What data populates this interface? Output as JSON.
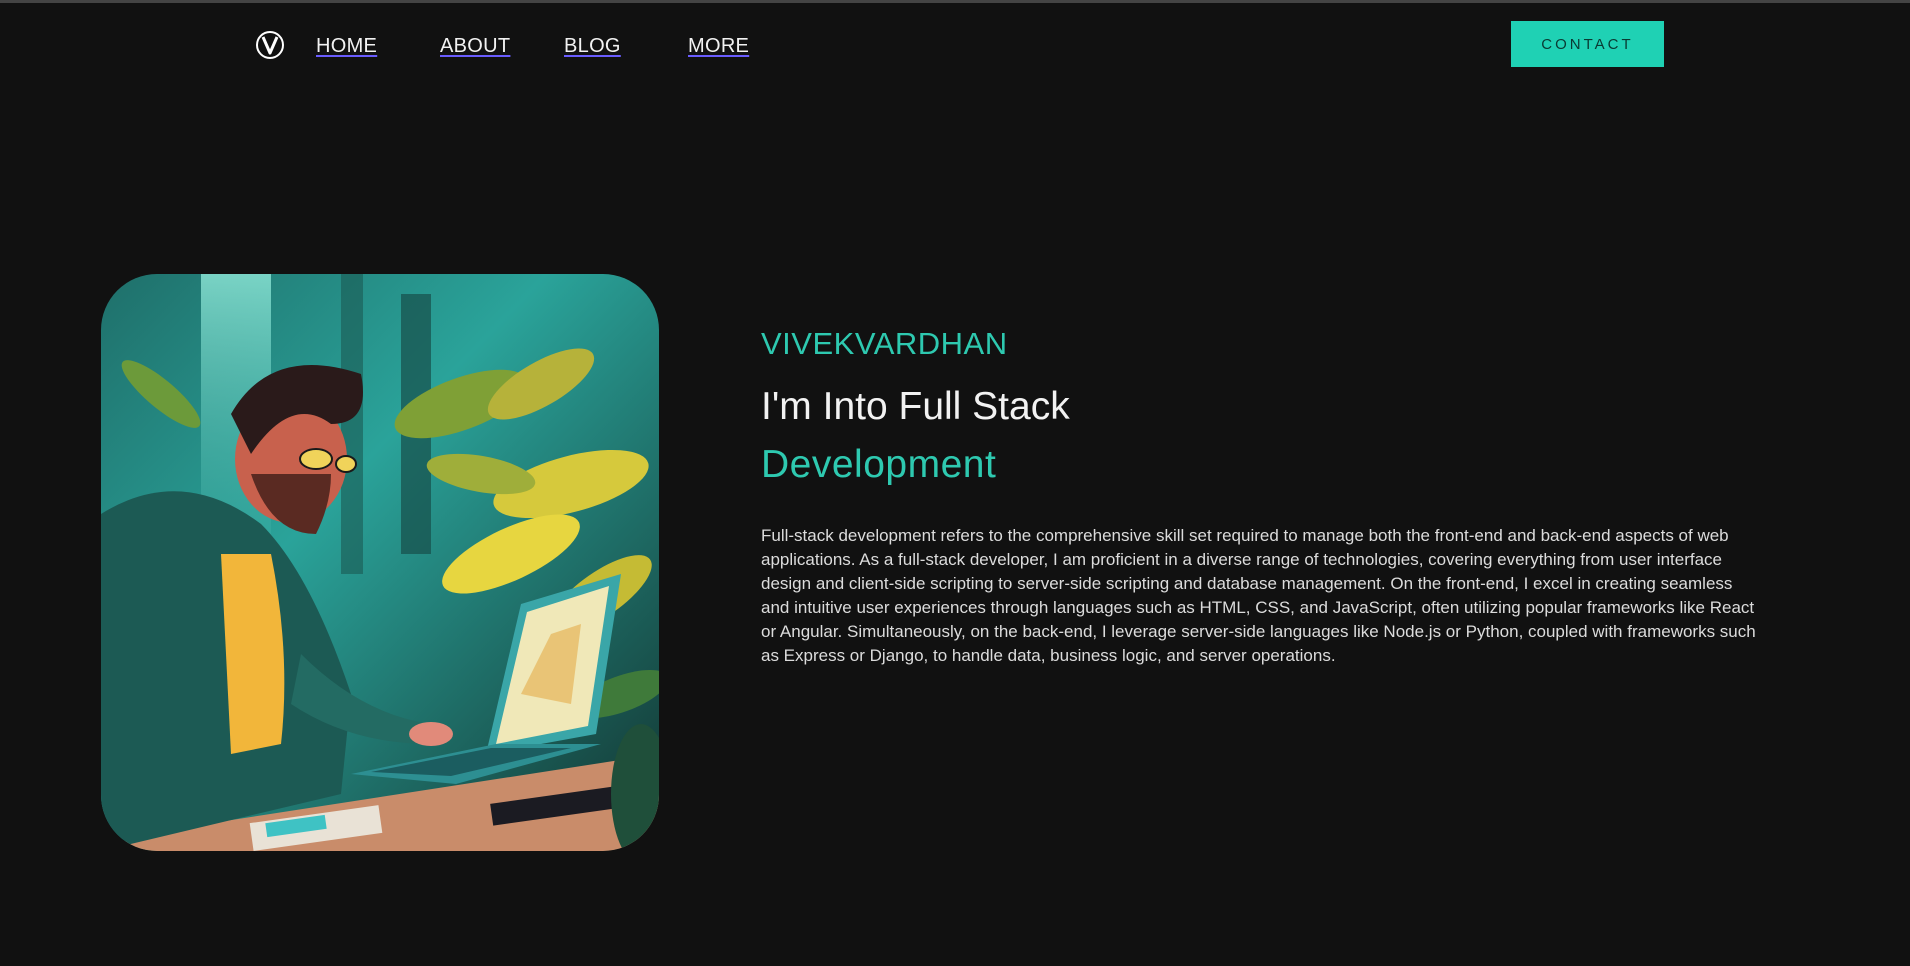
{
  "nav": {
    "logo_icon": "v-logo-icon",
    "links": [
      {
        "label": "HOME"
      },
      {
        "label": "ABOUT"
      },
      {
        "label": "BLOG"
      },
      {
        "label": "MORE"
      }
    ],
    "contact_label": "CONTACT"
  },
  "hero": {
    "image": "illustration of developer typing on laptop in forest",
    "name": "VIVEKVARDHAN",
    "headline": "I'm Into Full Stack",
    "headline_accent": "Development",
    "bio": "Full-stack development refers to the comprehensive skill set required to manage both the front-end and back-end aspects of web applications. As a full-stack developer, I am proficient in a diverse range of technologies, covering everything from user interface design and client-side scripting to server-side scripting and database management. On the front-end, I excel in creating seamless and intuitive user experiences through languages such as HTML, CSS, and JavaScript, often utilizing popular frameworks like React or Angular. Simultaneously, on the back-end, I leverage server-side languages like Node.js or Python, coupled with frameworks such as Express or Django, to handle data, business logic, and server operations."
  },
  "colors": {
    "background": "#111111",
    "accent": "#2ec9b0",
    "button": "#1fd1b4"
  }
}
